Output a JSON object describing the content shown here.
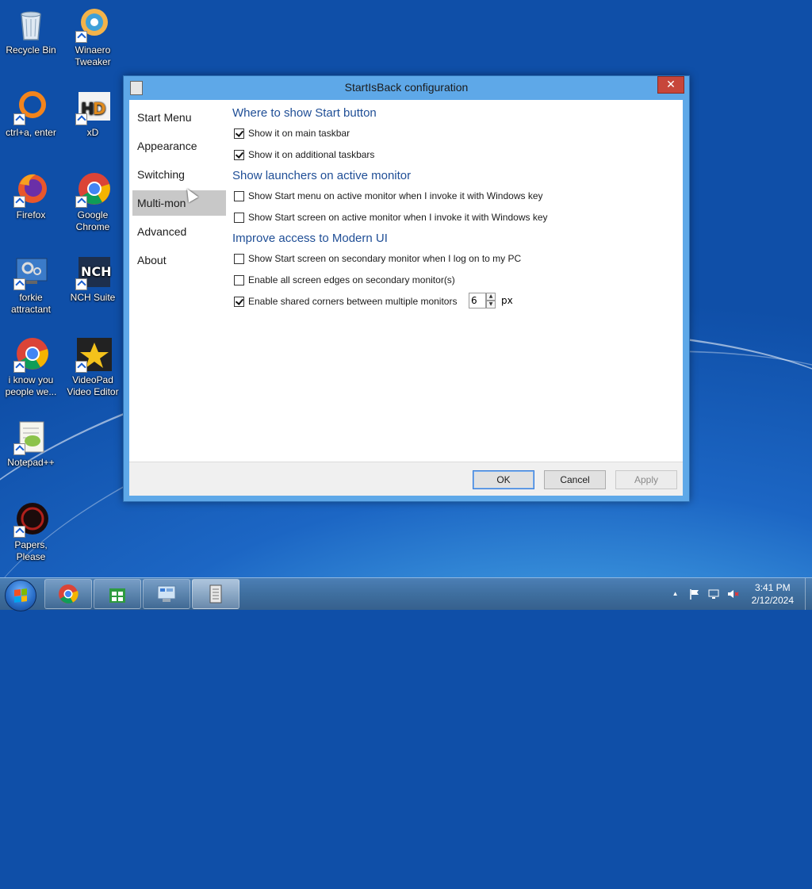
{
  "desktop": {
    "icons": [
      {
        "label": "Recycle Bin"
      },
      {
        "label": "Winaero Tweaker"
      },
      {
        "label": "ctrl+a, enter"
      },
      {
        "label": "xD"
      },
      {
        "label": "Firefox"
      },
      {
        "label": "Google Chrome"
      },
      {
        "label": "forkie attractant"
      },
      {
        "label": "NCH Suite"
      },
      {
        "label": "i know you people we..."
      },
      {
        "label": "VideoPad Video Editor"
      },
      {
        "label": "Notepad++"
      },
      {
        "label": "Papers, Please"
      }
    ]
  },
  "dialog": {
    "title": "StartIsBack configuration",
    "close_glyph": "✕",
    "nav": [
      {
        "label": "Start Menu"
      },
      {
        "label": "Appearance"
      },
      {
        "label": "Switching"
      },
      {
        "label": "Multi-mon",
        "selected": true
      },
      {
        "label": "Advanced"
      },
      {
        "label": "About"
      }
    ],
    "sections": {
      "start_button": {
        "title": "Where to show Start button",
        "options": [
          {
            "label": "Show it on main taskbar",
            "checked": true
          },
          {
            "label": "Show it on additional taskbars",
            "checked": true
          }
        ]
      },
      "launchers": {
        "title": "Show launchers on active monitor",
        "options": [
          {
            "label": "Show Start menu on active monitor when I invoke it with Windows key",
            "checked": false
          },
          {
            "label": "Show Start screen on active monitor when I invoke it with Windows key",
            "checked": false
          }
        ]
      },
      "modern_ui": {
        "title": "Improve access to Modern UI",
        "options": [
          {
            "label": "Show Start screen on secondary monitor when I log on to my PC",
            "checked": false
          },
          {
            "label": "Enable all screen edges on secondary monitor(s)",
            "checked": false
          },
          {
            "label": "Enable shared corners between multiple monitors",
            "checked": true
          }
        ],
        "corner_size_value": "6",
        "corner_size_unit": "px"
      }
    },
    "buttons": {
      "ok": "OK",
      "cancel": "Cancel",
      "apply": "Apply"
    }
  },
  "taskbar": {
    "clock_time": "3:41 PM",
    "clock_date": "2/12/2024",
    "tray_chevron": "▲"
  }
}
